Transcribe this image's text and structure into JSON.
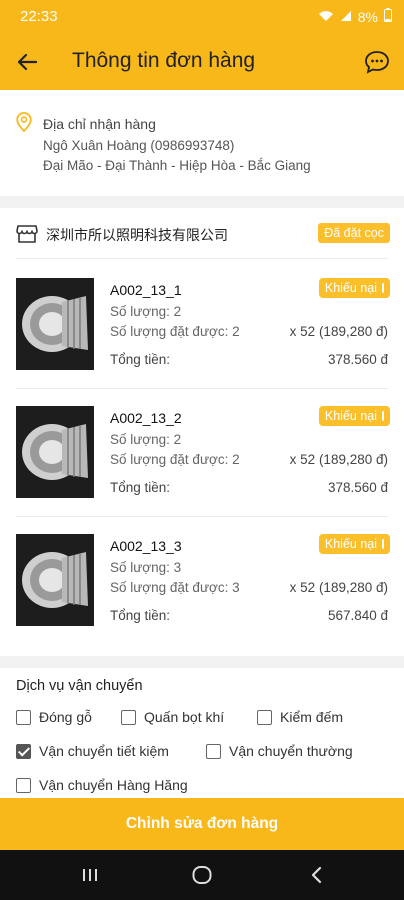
{
  "status_bar": {
    "time": "22:33",
    "battery": "8%"
  },
  "header": {
    "title": "Thông tin đơn hàng"
  },
  "address": {
    "label": "Địa chỉ nhận hàng",
    "name_phone": "Ngô Xuân Hoàng (0986993748)",
    "location": "Đại Mão - Đại Thành - Hiệp Hòa - Bắc Giang"
  },
  "order": {
    "shop_name": "深圳市所以照明科技有限公司",
    "status_badge": "Đã đặt cọc",
    "items": [
      {
        "sku": "A002_13_1",
        "complain_label": "Khiếu nại",
        "quantity": "Số lượng: 2",
        "achieved_label": "Số lượng đặt được: 2",
        "unit_price": "x 52 (189,280 đ)",
        "total_label": "Tổng tiền:",
        "total_value": "378.560 đ"
      },
      {
        "sku": "A002_13_2",
        "complain_label": "Khiếu nại",
        "quantity": "Số lượng: 2",
        "achieved_label": "Số lượng đặt được: 2",
        "unit_price": "x 52 (189,280 đ)",
        "total_label": "Tổng tiền:",
        "total_value": "378.560 đ"
      },
      {
        "sku": "A002_13_3",
        "complain_label": "Khiếu nại",
        "quantity": "Số lượng: 3",
        "achieved_label": "Số lượng đặt được: 3",
        "unit_price": "x 52 (189,280 đ)",
        "total_label": "Tổng tiền:",
        "total_value": "567.840 đ"
      }
    ]
  },
  "shipping": {
    "title": "Dịch vụ vận chuyển",
    "options": [
      {
        "label": "Đóng gỗ",
        "checked": false
      },
      {
        "label": "Quấn bọt khí",
        "checked": false
      },
      {
        "label": "Kiểm đếm",
        "checked": false
      },
      {
        "label": "Vận chuyển tiết kiệm",
        "checked": true
      },
      {
        "label": "Vận chuyển thường",
        "checked": false
      },
      {
        "label": "Vận chuyển Hàng Hăng",
        "checked": false
      }
    ]
  },
  "footer": {
    "edit_button": "Chỉnh sửa đơn hàng"
  },
  "colors": {
    "accent": "#f9b81a",
    "badge": "#fbbf2c",
    "nav_bar": "#111111"
  },
  "icons": [
    "back-arrow-icon",
    "chat-bubble-icon",
    "location-pin-icon",
    "shop-icon",
    "exclamation-icon",
    "checkbox-icon",
    "recent-apps-icon",
    "home-icon",
    "nav-back-icon"
  ]
}
